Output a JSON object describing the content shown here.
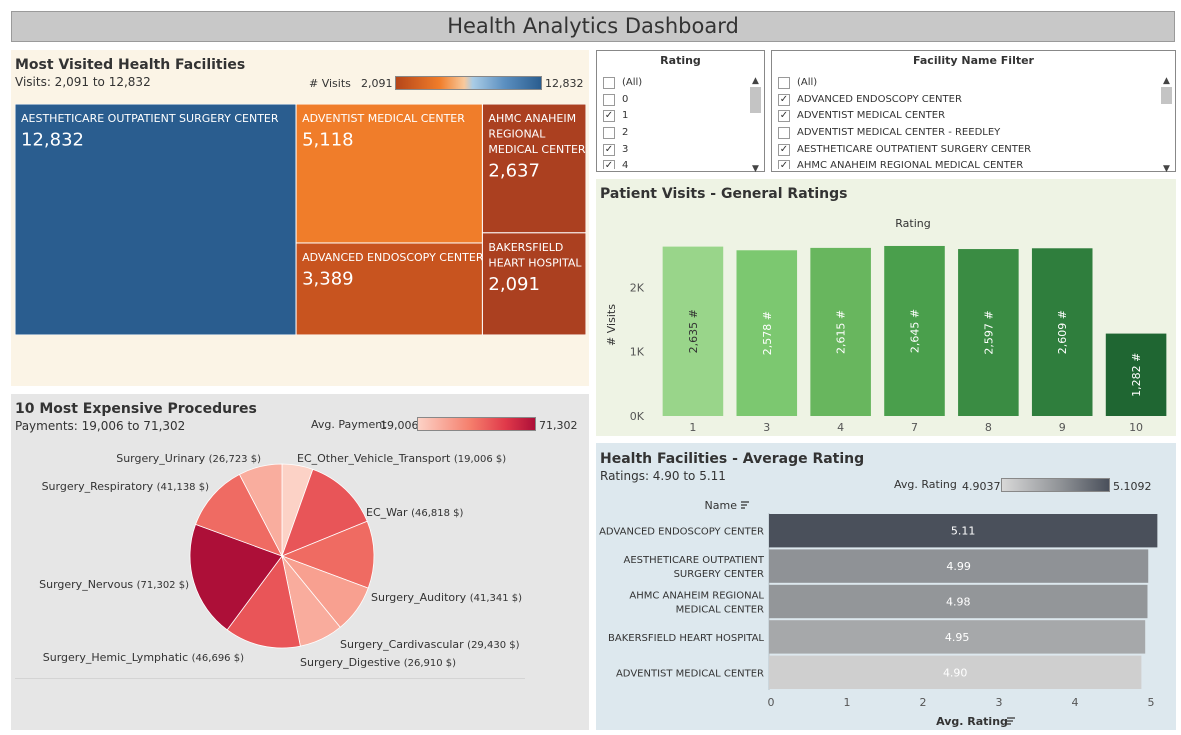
{
  "title": "Health Analytics Dashboard",
  "treemap": {
    "title": "Most Visited Health Facilities",
    "subtitle": "Visits: 2,091 to 12,832",
    "legend_label": "# Visits",
    "legend_min": "2,091",
    "legend_max": "12,832",
    "colors": {
      "blue": "#2a5d8f",
      "orange": "#f07d2a",
      "mid": "#c8541f",
      "dark": "#ab4020"
    },
    "tiles": [
      {
        "name": "AESTHETICARE OUTPATIENT SURGERY CENTER",
        "value": 12832,
        "label": "12,832"
      },
      {
        "name": "ADVENTIST MEDICAL CENTER",
        "value": 5118,
        "label": "5,118"
      },
      {
        "name": "ADVANCED ENDOSCOPY CENTER",
        "value": 3389,
        "label": "3,389"
      },
      {
        "name": "AHMC ANAHEIM REGIONAL MEDICAL CENTER",
        "value": 2637,
        "label": "2,637"
      },
      {
        "name": "BAKERSFIELD HEART HOSPITAL",
        "value": 2091,
        "label": "2,091"
      }
    ]
  },
  "rating_filter": {
    "title": "Rating",
    "items": [
      {
        "label": "(All)",
        "checked": false
      },
      {
        "label": "0",
        "checked": false
      },
      {
        "label": "1",
        "checked": true
      },
      {
        "label": "2",
        "checked": false
      },
      {
        "label": "3",
        "checked": true
      },
      {
        "label": "4",
        "checked": true
      }
    ]
  },
  "facility_filter": {
    "title": "Facility Name Filter",
    "items": [
      {
        "label": "(All)",
        "checked": false
      },
      {
        "label": "ADVANCED ENDOSCOPY CENTER",
        "checked": true
      },
      {
        "label": "ADVENTIST MEDICAL CENTER",
        "checked": true
      },
      {
        "label": "ADVENTIST MEDICAL CENTER - REEDLEY",
        "checked": false
      },
      {
        "label": "AESTHETICARE OUTPATIENT SURGERY CENTER",
        "checked": true
      },
      {
        "label": "AHMC ANAHEIM REGIONAL MEDICAL CENTER",
        "checked": true
      }
    ]
  },
  "chart_data": [
    {
      "type": "bar",
      "title": "Patient Visits - General Ratings",
      "top_label": "Rating",
      "ylabel": "# Visits",
      "categories": [
        "1",
        "3",
        "4",
        "7",
        "8",
        "9",
        "10"
      ],
      "values": [
        2635,
        2578,
        2615,
        2645,
        2597,
        2609,
        1282
      ],
      "data_labels": [
        "2,635 #",
        "2,578 #",
        "2,615 #",
        "2,645 #",
        "2,597 #",
        "2,609 #",
        "1,282 #"
      ],
      "colors": [
        "#99d58a",
        "#7cc870",
        "#68b65e",
        "#4a9f4c",
        "#3a8c43",
        "#2f7e3d",
        "#1f6632"
      ],
      "yticks": [
        0,
        1000,
        2000
      ],
      "ytick_labels": [
        "0K",
        "1K",
        "2K"
      ],
      "ylim": [
        0,
        2800
      ]
    },
    {
      "type": "pie",
      "title": "10 Most Expensive Procedures",
      "subtitle": "Payments: 19,006 to 71,302",
      "legend_label": "Avg. Payment",
      "legend_min": "19,006",
      "legend_max": "71,302",
      "slices": [
        {
          "name": "EC_Other_Vehicle_Transport",
          "value": 19006,
          "label": "(19,006 $)"
        },
        {
          "name": "EC_War",
          "value": 46818,
          "label": "(46,818 $)"
        },
        {
          "name": "Surgery_Auditory",
          "value": 41341,
          "label": "(41,341 $)"
        },
        {
          "name": "Surgery_Cardivascular",
          "value": 29430,
          "label": "(29,430 $)"
        },
        {
          "name": "Surgery_Digestive",
          "value": 26910,
          "label": "(26,910 $)"
        },
        {
          "name": "Surgery_Hemic_Lymphatic",
          "value": 46696,
          "label": "(46,696 $)"
        },
        {
          "name": "Surgery_Nervous",
          "value": 71302,
          "label": "(71,302 $)"
        },
        {
          "name": "Surgery_Respiratory",
          "value": 41138,
          "label": "(41,138 $)"
        },
        {
          "name": "Surgery_Urinary",
          "value": 26723,
          "label": "(26,723 $)"
        }
      ]
    },
    {
      "type": "bar",
      "orientation": "horizontal",
      "title": "Health Facilities - Average Rating",
      "subtitle": "Ratings: 4.90 to 5.11",
      "legend_label": "Avg. Rating",
      "legend_min": "4.9037",
      "legend_max": "5.1092",
      "row_header": "Name",
      "xlabel": "Avg. Rating",
      "categories": [
        "ADVANCED ENDOSCOPY CENTER",
        "AESTHETICARE OUTPATIENT SURGERY CENTER",
        "AHMC ANAHEIM REGIONAL MEDICAL CENTER",
        "BAKERSFIELD HEART HOSPITAL",
        "ADVENTIST MEDICAL CENTER"
      ],
      "category_lines": [
        [
          "ADVANCED ENDOSCOPY CENTER"
        ],
        [
          "AESTHETICARE OUTPATIENT",
          "SURGERY CENTER"
        ],
        [
          "AHMC ANAHEIM REGIONAL",
          "MEDICAL CENTER"
        ],
        [
          "BAKERSFIELD HEART HOSPITAL"
        ],
        [
          "ADVENTIST MEDICAL CENTER"
        ]
      ],
      "values": [
        5.11,
        4.99,
        4.98,
        4.95,
        4.9
      ],
      "data_labels": [
        "5.11",
        "4.99",
        "4.98",
        "4.95",
        "4.90"
      ],
      "colors": [
        "#4a505b",
        "#8f9296",
        "#939699",
        "#a6a8aa",
        "#cfcfcf"
      ],
      "xticks": [
        "0",
        "1",
        "2",
        "3",
        "4",
        "5"
      ],
      "xlim": [
        0,
        5.15
      ]
    }
  ]
}
